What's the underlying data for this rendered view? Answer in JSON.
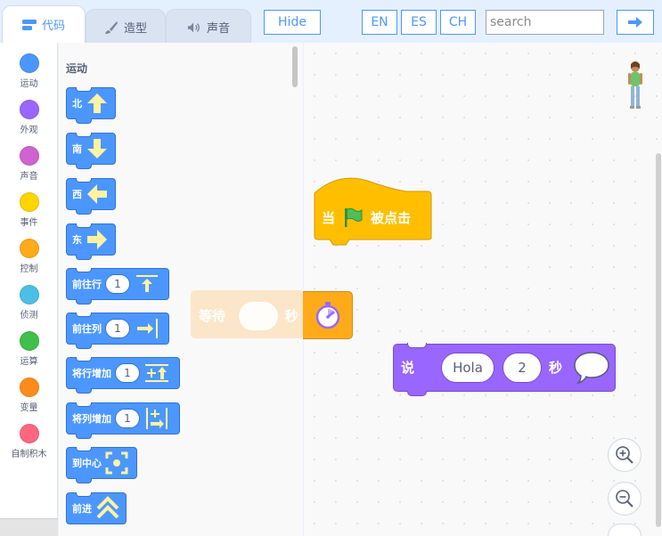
{
  "tabs": {
    "code": "代码",
    "costumes": "造型",
    "sounds": "声音"
  },
  "toolbar": {
    "hide_label": "Hide",
    "lang_en": "EN",
    "lang_es": "ES",
    "lang_ch": "CH",
    "search_placeholder": "search",
    "go_icon": "arrow-right-icon"
  },
  "categories": [
    {
      "label": "运动",
      "color": "#4c97ff"
    },
    {
      "label": "外观",
      "color": "#9966ff"
    },
    {
      "label": "声音",
      "color": "#cf63cf"
    },
    {
      "label": "事件",
      "color": "#ffd500"
    },
    {
      "label": "控制",
      "color": "#ffab19"
    },
    {
      "label": "侦测",
      "color": "#4cbfe6"
    },
    {
      "label": "运算",
      "color": "#40bf4a"
    },
    {
      "label": "变量",
      "color": "#ff8c1a"
    },
    {
      "label": "自制积木",
      "color": "#ff6680"
    }
  ],
  "palette": {
    "section_title": "运动",
    "blocks": [
      {
        "label": "北",
        "icon": "arrow-up-icon"
      },
      {
        "label": "南",
        "icon": "arrow-down-icon"
      },
      {
        "label": "西",
        "icon": "arrow-left-icon"
      },
      {
        "label": "东",
        "icon": "arrow-right-icon"
      },
      {
        "label": "前往行",
        "value": "1",
        "icon": "go-to-row-icon"
      },
      {
        "label": "前往列",
        "value": "1",
        "icon": "go-to-column-icon"
      },
      {
        "label": "将行增加",
        "value": "1",
        "icon": "row-increase-icon"
      },
      {
        "label": "将列增加",
        "value": "1",
        "icon": "column-increase-icon"
      },
      {
        "label": "到中心",
        "icon": "center-icon"
      },
      {
        "label": "前进",
        "icon": "forward-icon"
      }
    ]
  },
  "workspace": {
    "hat_when": "当",
    "hat_clicked": "被点击",
    "wait_label": "等待",
    "wait_unit": "秒",
    "say_label": "说",
    "say_text": "Hola",
    "say_seconds": "2",
    "say_unit": "秒"
  },
  "colors": {
    "motion": "#4c97ff",
    "events": "#ffbf00",
    "control": "#ffab19",
    "looks": "#9966ff"
  }
}
